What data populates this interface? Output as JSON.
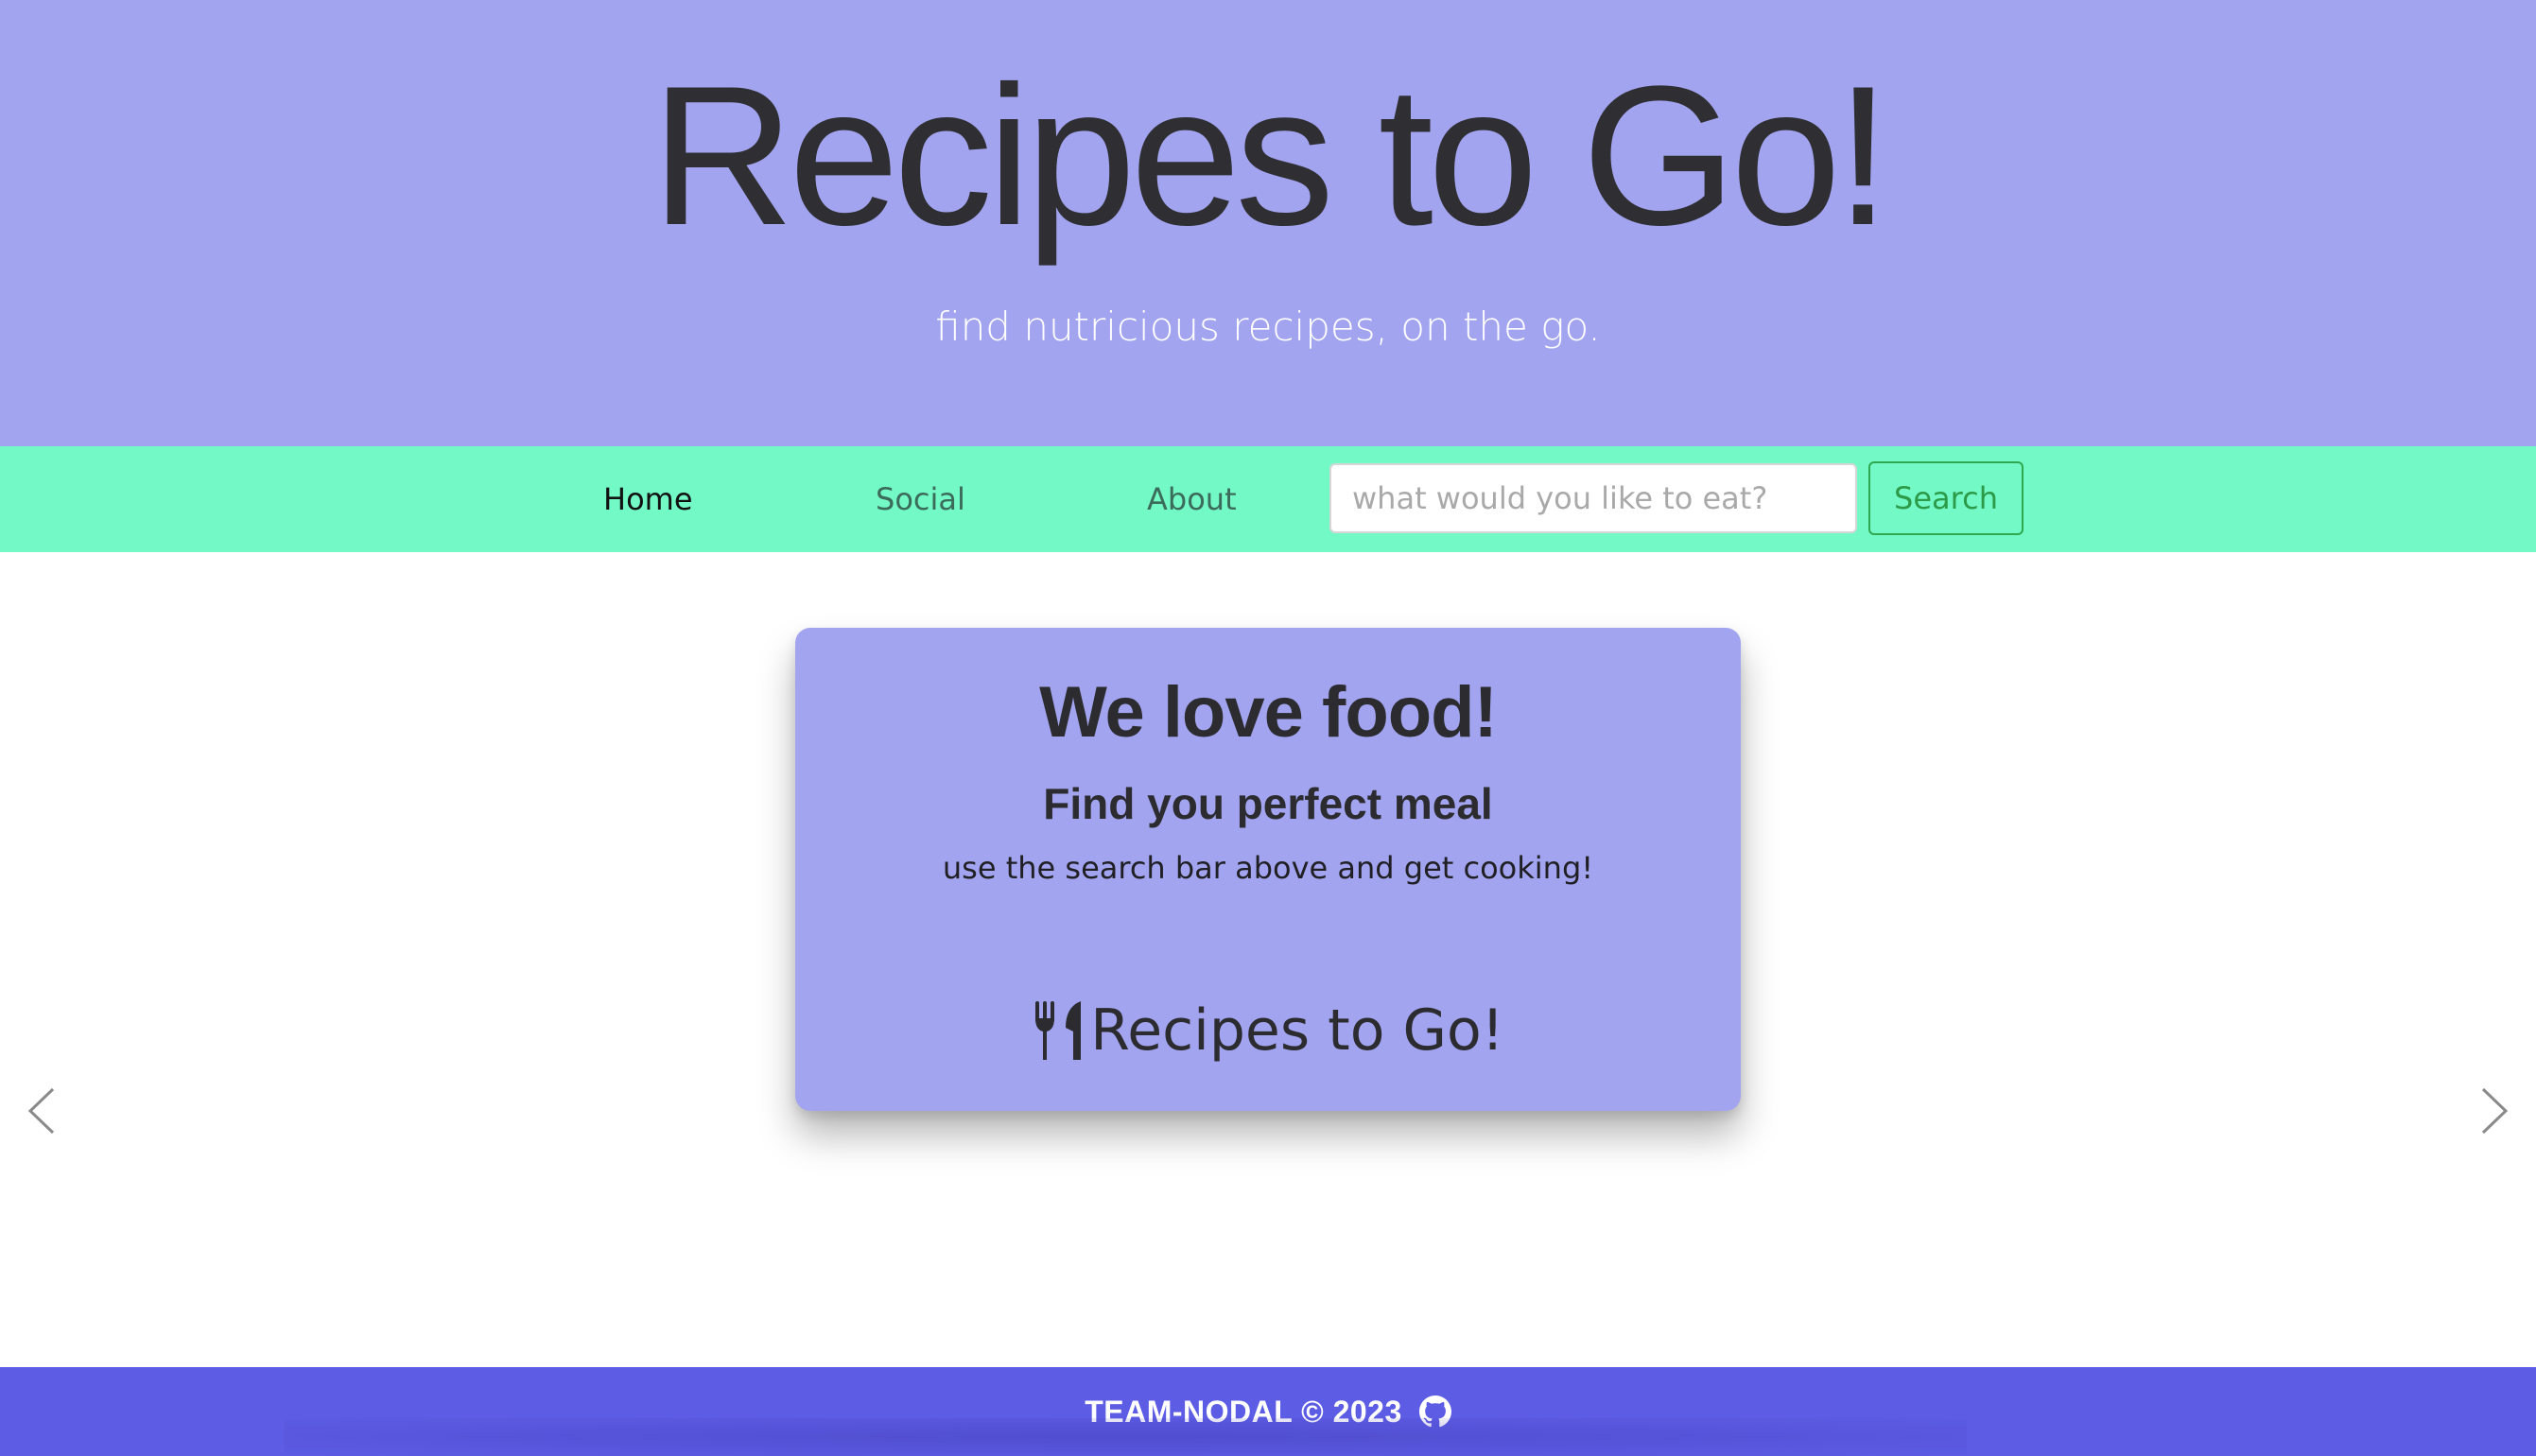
{
  "header": {
    "title": "Recipes to Go!",
    "subtitle": "find nutricious recipes, on the go."
  },
  "nav": {
    "links": [
      {
        "label": "Home",
        "active": true
      },
      {
        "label": "Social",
        "active": false
      },
      {
        "label": "About",
        "active": false
      }
    ],
    "search": {
      "placeholder": "what would you like to eat?",
      "value": "",
      "button_label": "Search"
    }
  },
  "carousel": {
    "slide": {
      "title": "We love food!",
      "subtitle": "Find you perfect meal",
      "text": "use the search bar above and get cooking!",
      "brand_icon": "utensils-icon",
      "brand_text": "Recipes to Go!"
    },
    "prev_icon": "chevron-left-icon",
    "next_icon": "chevron-right-icon"
  },
  "footer": {
    "text": "TEAM-NODAL © 2023",
    "icon": "github-icon"
  },
  "colors": {
    "hero_bg": "#a2a4ef",
    "nav_bg": "#73f9c6",
    "card_bg": "#a2a4ef",
    "footer_bg": "#5c5ce4",
    "search_button": "#2c9a48"
  }
}
